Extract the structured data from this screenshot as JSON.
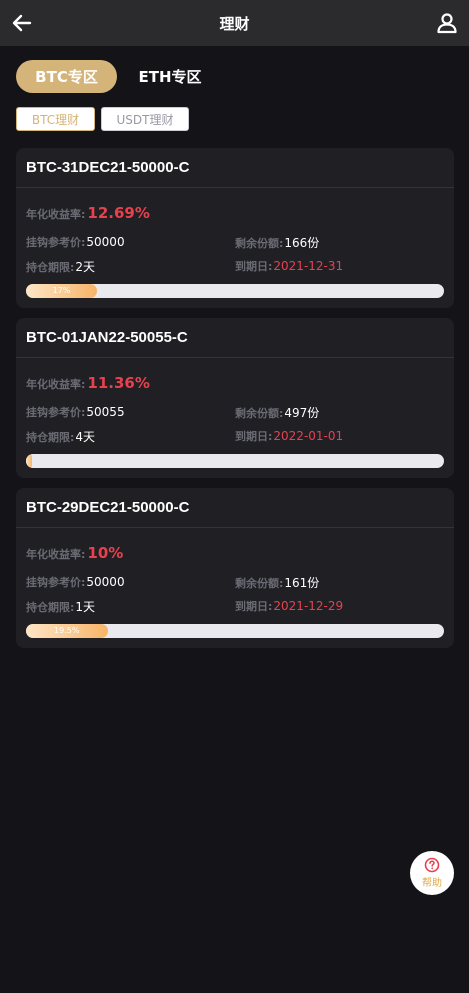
{
  "header": {
    "title": "理财",
    "back_icon": "arrow-left-icon",
    "user_icon": "user-icon"
  },
  "zones": {
    "items": [
      {
        "label": "BTC专区",
        "active": true
      },
      {
        "label": "ETH专区",
        "active": false
      }
    ]
  },
  "sub_tabs": {
    "items": [
      {
        "label": "BTC理财",
        "active": true
      },
      {
        "label": "USDT理财",
        "active": false
      }
    ]
  },
  "labels": {
    "rate": "年化收益率:",
    "ref_price": "挂钩参考价:",
    "remaining": "剩余份额:",
    "period": "持仓期限:",
    "expiry": "到期日:"
  },
  "products": [
    {
      "name": "BTC-31DEC21-50000-C",
      "rate": "12.69%",
      "ref_price": "50000",
      "remaining": "166份",
      "period": "2天",
      "expiry": "2021-12-31",
      "progress": 17,
      "progress_label": "17%"
    },
    {
      "name": "BTC-01JAN22-50055-C",
      "rate": "11.36%",
      "ref_price": "50055",
      "remaining": "497份",
      "period": "4天",
      "expiry": "2022-01-01",
      "progress": 1,
      "progress_label": ""
    },
    {
      "name": "BTC-29DEC21-50000-C",
      "rate": "10%",
      "ref_price": "50000",
      "remaining": "161份",
      "period": "1天",
      "expiry": "2021-12-29",
      "progress": 19.5,
      "progress_label": "19.5%"
    }
  ],
  "help": {
    "label": "帮助",
    "icon": "question-circle-icon"
  },
  "colors": {
    "accent": "#d5b47a",
    "rate_red": "#e8414e",
    "background": "#141418",
    "card": "#1f1f24"
  }
}
